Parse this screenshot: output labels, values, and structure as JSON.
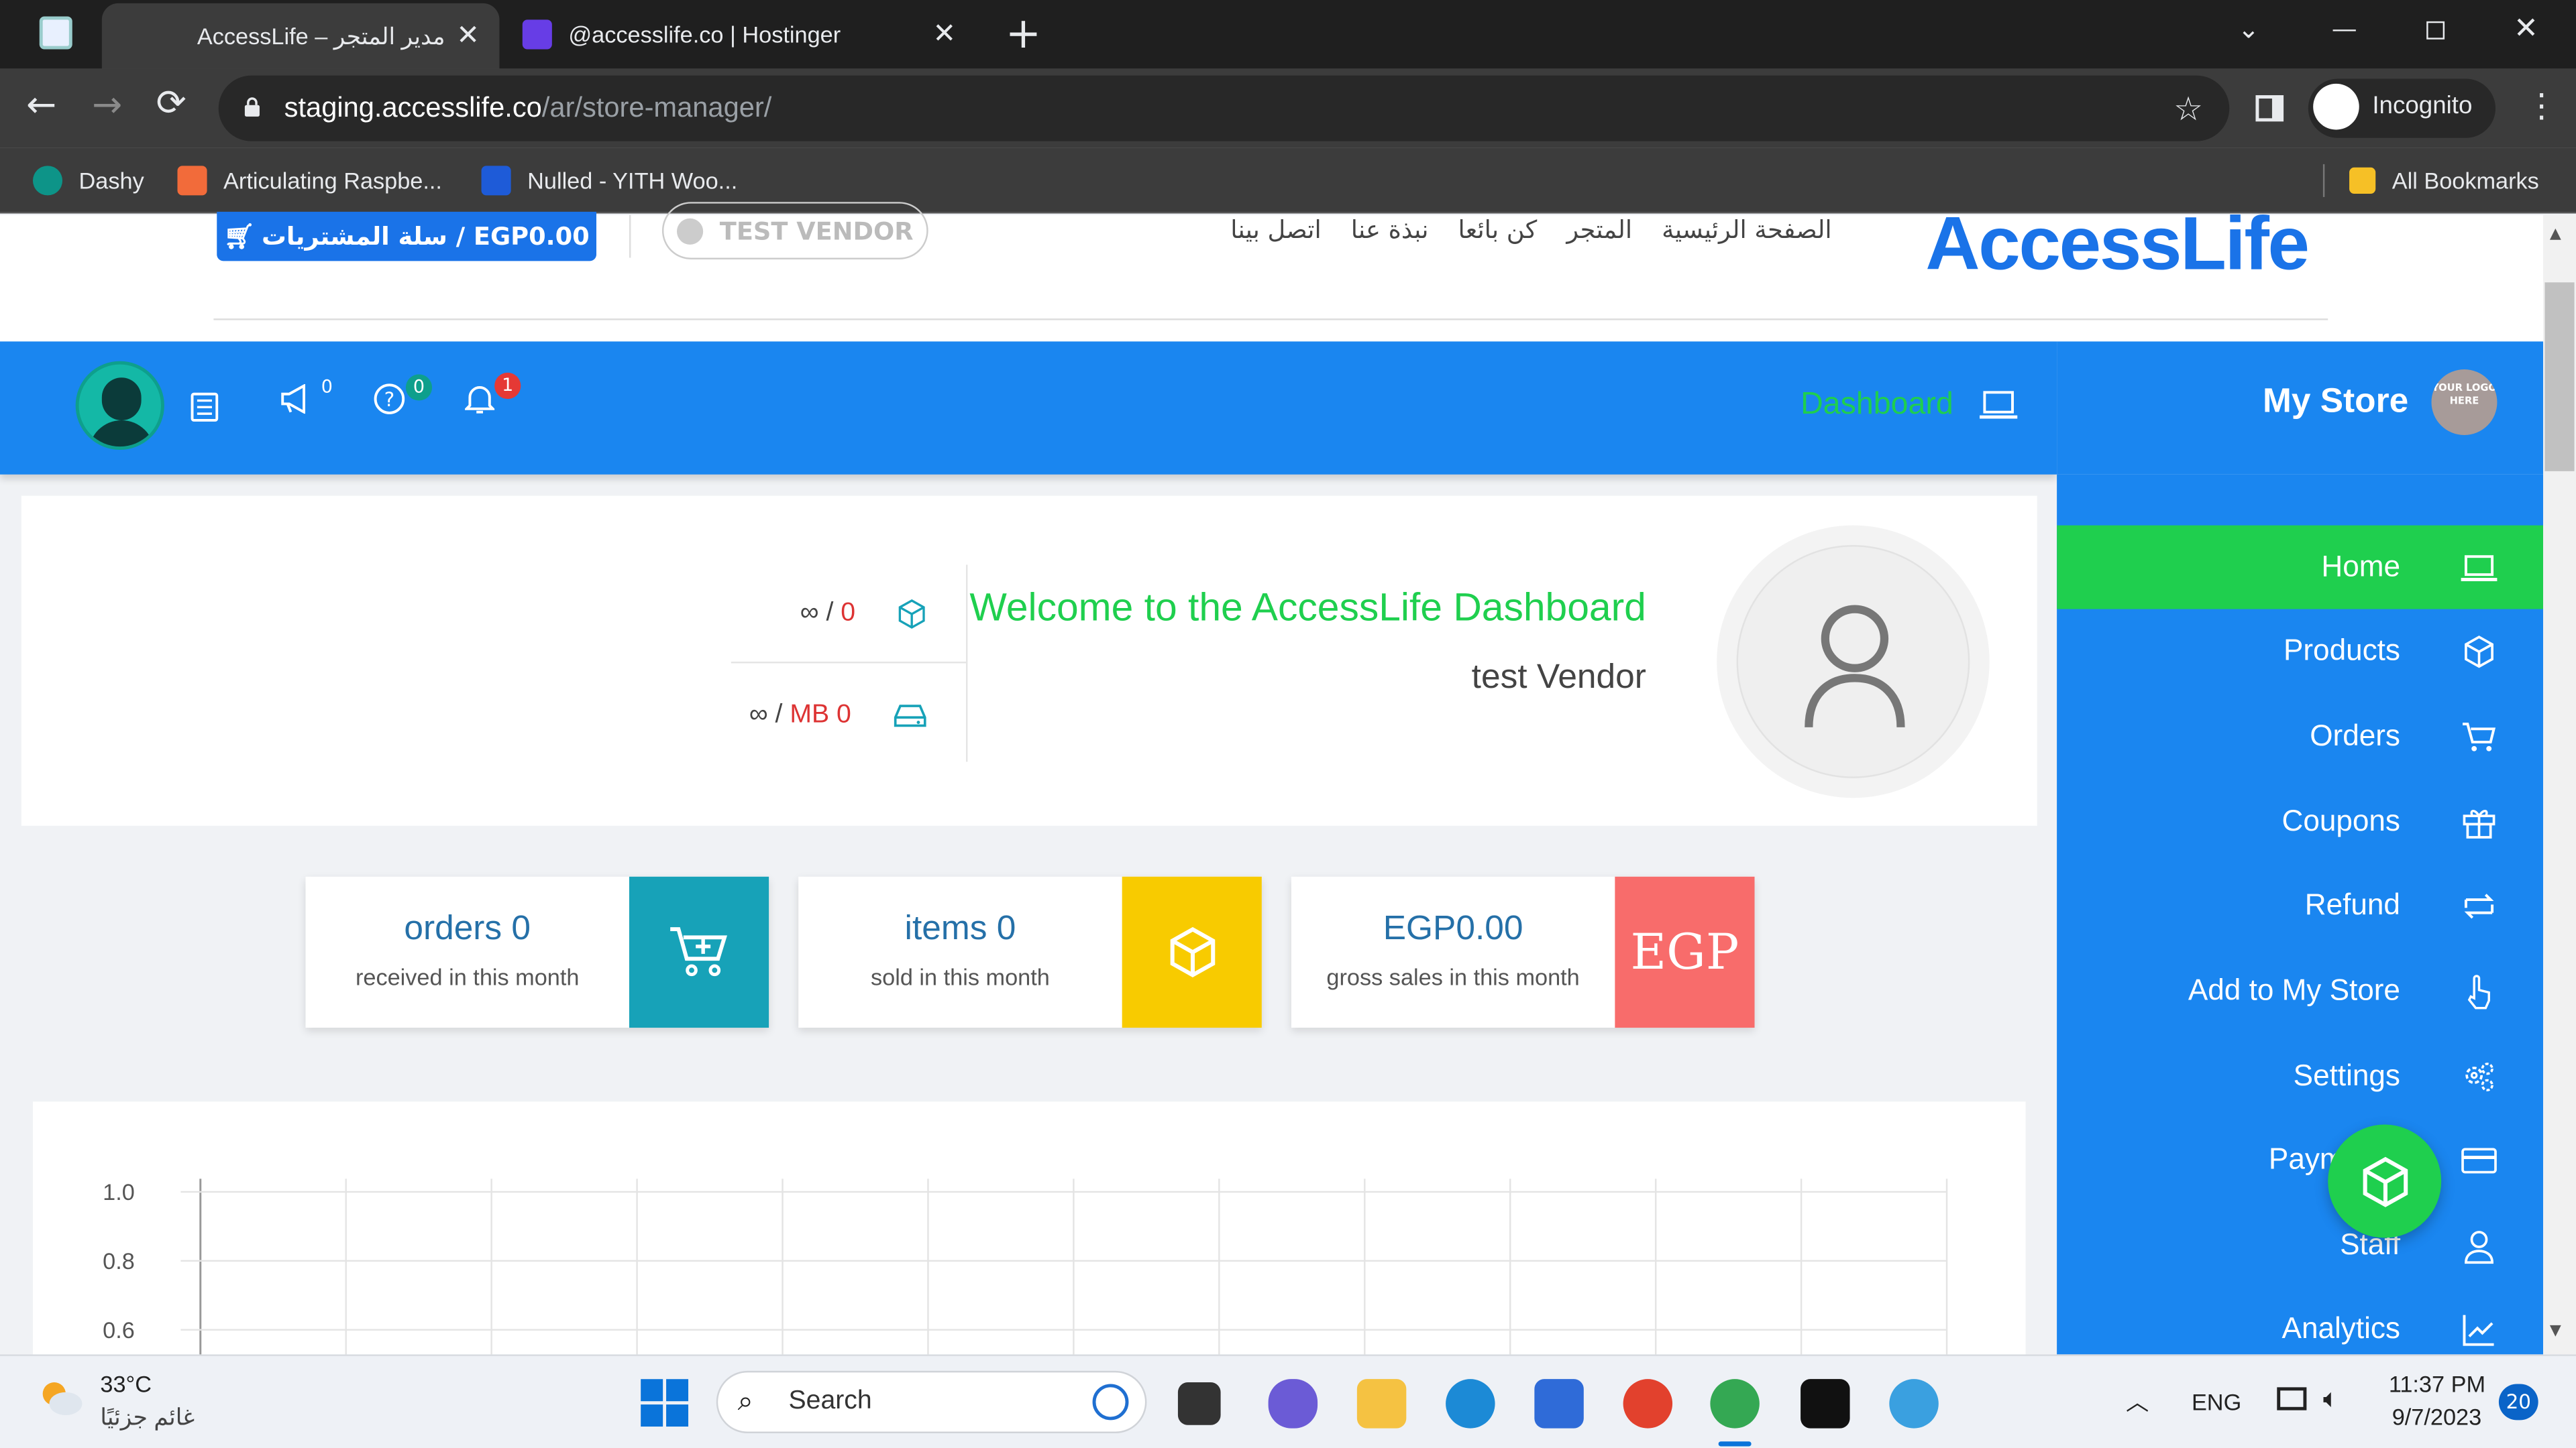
{
  "browser": {
    "tabs": [
      {
        "title": "AccessLife – مدير المتجر",
        "active": true
      },
      {
        "title": "@accesslife.co | Hostinger",
        "active": false
      }
    ],
    "url_host": "staging.accesslife.co",
    "url_path": "/ar/store-manager/",
    "profile_label": "Incognito",
    "bookmarks": [
      "Dashy",
      "Articulating Raspbe...",
      "Nulled - YITH Woo..."
    ],
    "all_bookmarks_label": "All Bookmarks"
  },
  "site_header": {
    "cart_label": "سلة المشتريات / EGP0.00",
    "vendor_label": "TEST VENDOR",
    "nav": [
      "الصفحة الرئيسية",
      "المتجر",
      "كن بائعا",
      "نبذة عنا",
      "اتصل بينا"
    ],
    "logo_text": "AccessLife"
  },
  "topbar": {
    "dashboard_label": "Dashboard",
    "badges": {
      "announcements": "0",
      "help": "0",
      "notifications": "1"
    }
  },
  "sidebar": {
    "store_title": "My Store",
    "logo_placeholder": "YOUR LOGO HERE",
    "items": [
      {
        "label": "Home",
        "icon": "laptop-icon",
        "active": true
      },
      {
        "label": "Products",
        "icon": "cube-icon"
      },
      {
        "label": "Orders",
        "icon": "cart-icon"
      },
      {
        "label": "Coupons",
        "icon": "gift-icon"
      },
      {
        "label": "Refund",
        "icon": "refund-icon"
      },
      {
        "label": "Add to My Store",
        "icon": "hand-pointer-icon"
      },
      {
        "label": "Settings",
        "icon": "gears-icon"
      },
      {
        "label": "Payments",
        "icon": "credit-card-icon"
      },
      {
        "label": "Staff",
        "icon": "user-icon"
      },
      {
        "label": "Analytics",
        "icon": "chart-icon"
      }
    ]
  },
  "welcome": {
    "heading": "Welcome to the AccessLife Dashboard",
    "vendor_name": "test Vendor",
    "products_used": "0",
    "products_limit": "∞",
    "space_used": "MB 0",
    "space_limit": "∞"
  },
  "cards": [
    {
      "big": "orders 0",
      "small": "received in this month",
      "color": "#17a2b8",
      "icon": "cart-plus-icon"
    },
    {
      "big": "items 0",
      "small": "sold in this month",
      "color": "#f8cb00",
      "icon": "cube-icon"
    },
    {
      "big": "EGP0.00",
      "small": "gross sales in this month",
      "color": "#f86c6b",
      "icon_text": "EGP"
    }
  ],
  "chart_data": {
    "type": "line",
    "y_ticks": [
      "1.0",
      "0.8",
      "0.6"
    ],
    "ylim": [
      0,
      1
    ],
    "grid": true
  },
  "taskbar": {
    "weather_temp": "33°C",
    "weather_desc": "غائم جزئيًا",
    "search_placeholder": "Search",
    "language": "ENG",
    "time": "11:37 PM",
    "date": "9/7/2023",
    "notification_count": "20"
  }
}
